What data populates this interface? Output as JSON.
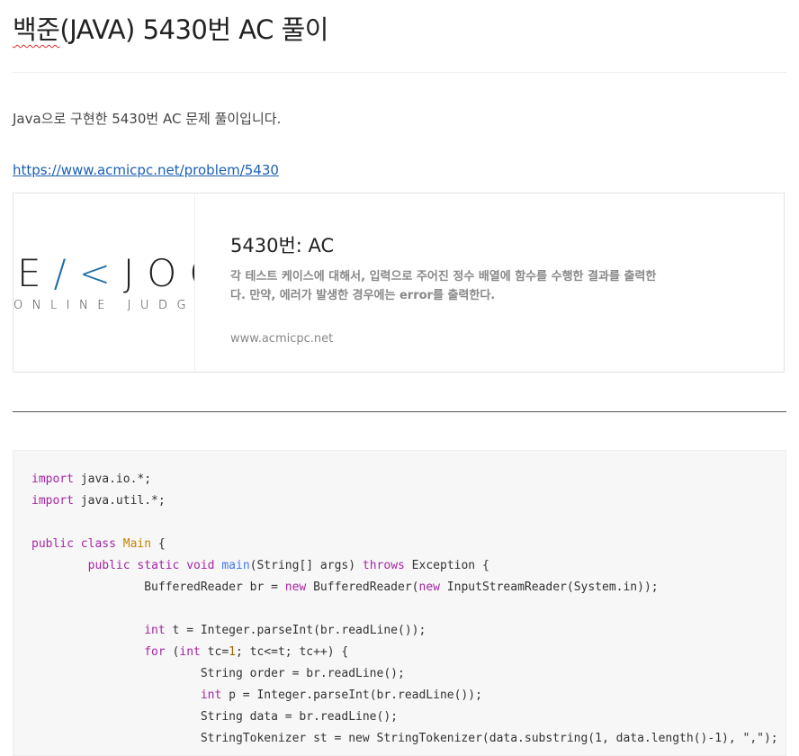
{
  "post": {
    "title_prefix": "백준",
    "title_rest": "(JAVA) 5430번 AC 풀이",
    "intro": "Java으로 구현한 5430번 AC 문제 풀이입니다.",
    "link": "https://www.acmicpc.net/problem/5430"
  },
  "card": {
    "logo_main_a": "E",
    "logo_main_accent": "/<",
    "logo_main_b": "JOO",
    "logo_sub": "ONLINE JUDGE",
    "title": "5430번: AC",
    "description": "각 테스트 케이스에 대해서, 입력으로 주어진 정수 배열에 함수를 수행한 결과를 출력한다. 만약, 에러가 발생한 경우에는 error를 출력한다.",
    "domain": "www.acmicpc.net"
  },
  "code": {
    "l1_kw": "import",
    "l1_rest": " java.io.*;",
    "l2_kw": "import",
    "l2_rest": " java.util.*;",
    "l4_kw": "public class",
    "l4_cls": "Main",
    "l4_rest": " {",
    "l5_kw": "public static void",
    "l5_fn": "main",
    "l5_mid": "(String[] args) ",
    "l5_kw2": "throws",
    "l5_rest": " Exception {",
    "l6_a": "BufferedReader br = ",
    "l6_kw": "new",
    "l6_b": " BufferedReader(",
    "l6_kw2": "new",
    "l6_c": " InputStreamReader(System.in));",
    "l8_kw": "int",
    "l8_rest": " t = Integer.parseInt(br.readLine());",
    "l9_kw": "for",
    "l9_a": " (",
    "l9_kw2": "int",
    "l9_b": " tc=",
    "l9_num": "1",
    "l9_c": "; tc<=t; tc++) {",
    "l10": "String order = br.readLine();",
    "l11_kw": "int",
    "l11_rest": " p = Integer.parseInt(br.readLine());",
    "l12": "String data = br.readLine();",
    "l13": "StringTokenizer st = new StringTokenizer(data.substring(1, data.length()-1), \",\");"
  }
}
